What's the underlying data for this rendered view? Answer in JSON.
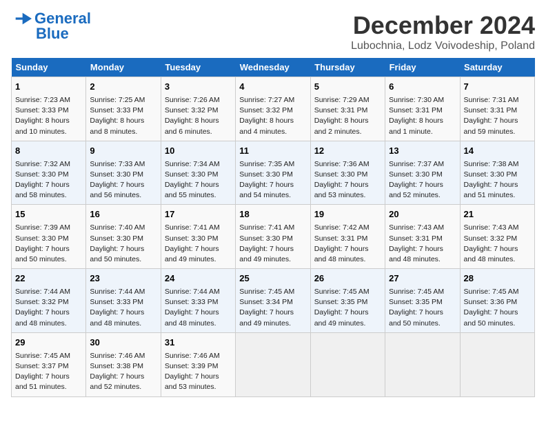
{
  "logo": {
    "line1": "General",
    "line2": "Blue"
  },
  "title": "December 2024",
  "subtitle": "Lubochnia, Lodz Voivodeship, Poland",
  "days_of_week": [
    "Sunday",
    "Monday",
    "Tuesday",
    "Wednesday",
    "Thursday",
    "Friday",
    "Saturday"
  ],
  "weeks": [
    [
      {
        "day": 1,
        "lines": [
          "Sunrise: 7:23 AM",
          "Sunset: 3:33 PM",
          "Daylight: 8 hours",
          "and 10 minutes."
        ]
      },
      {
        "day": 2,
        "lines": [
          "Sunrise: 7:25 AM",
          "Sunset: 3:33 PM",
          "Daylight: 8 hours",
          "and 8 minutes."
        ]
      },
      {
        "day": 3,
        "lines": [
          "Sunrise: 7:26 AM",
          "Sunset: 3:32 PM",
          "Daylight: 8 hours",
          "and 6 minutes."
        ]
      },
      {
        "day": 4,
        "lines": [
          "Sunrise: 7:27 AM",
          "Sunset: 3:32 PM",
          "Daylight: 8 hours",
          "and 4 minutes."
        ]
      },
      {
        "day": 5,
        "lines": [
          "Sunrise: 7:29 AM",
          "Sunset: 3:31 PM",
          "Daylight: 8 hours",
          "and 2 minutes."
        ]
      },
      {
        "day": 6,
        "lines": [
          "Sunrise: 7:30 AM",
          "Sunset: 3:31 PM",
          "Daylight: 8 hours",
          "and 1 minute."
        ]
      },
      {
        "day": 7,
        "lines": [
          "Sunrise: 7:31 AM",
          "Sunset: 3:31 PM",
          "Daylight: 7 hours",
          "and 59 minutes."
        ]
      }
    ],
    [
      {
        "day": 8,
        "lines": [
          "Sunrise: 7:32 AM",
          "Sunset: 3:30 PM",
          "Daylight: 7 hours",
          "and 58 minutes."
        ]
      },
      {
        "day": 9,
        "lines": [
          "Sunrise: 7:33 AM",
          "Sunset: 3:30 PM",
          "Daylight: 7 hours",
          "and 56 minutes."
        ]
      },
      {
        "day": 10,
        "lines": [
          "Sunrise: 7:34 AM",
          "Sunset: 3:30 PM",
          "Daylight: 7 hours",
          "and 55 minutes."
        ]
      },
      {
        "day": 11,
        "lines": [
          "Sunrise: 7:35 AM",
          "Sunset: 3:30 PM",
          "Daylight: 7 hours",
          "and 54 minutes."
        ]
      },
      {
        "day": 12,
        "lines": [
          "Sunrise: 7:36 AM",
          "Sunset: 3:30 PM",
          "Daylight: 7 hours",
          "and 53 minutes."
        ]
      },
      {
        "day": 13,
        "lines": [
          "Sunrise: 7:37 AM",
          "Sunset: 3:30 PM",
          "Daylight: 7 hours",
          "and 52 minutes."
        ]
      },
      {
        "day": 14,
        "lines": [
          "Sunrise: 7:38 AM",
          "Sunset: 3:30 PM",
          "Daylight: 7 hours",
          "and 51 minutes."
        ]
      }
    ],
    [
      {
        "day": 15,
        "lines": [
          "Sunrise: 7:39 AM",
          "Sunset: 3:30 PM",
          "Daylight: 7 hours",
          "and 50 minutes."
        ]
      },
      {
        "day": 16,
        "lines": [
          "Sunrise: 7:40 AM",
          "Sunset: 3:30 PM",
          "Daylight: 7 hours",
          "and 50 minutes."
        ]
      },
      {
        "day": 17,
        "lines": [
          "Sunrise: 7:41 AM",
          "Sunset: 3:30 PM",
          "Daylight: 7 hours",
          "and 49 minutes."
        ]
      },
      {
        "day": 18,
        "lines": [
          "Sunrise: 7:41 AM",
          "Sunset: 3:30 PM",
          "Daylight: 7 hours",
          "and 49 minutes."
        ]
      },
      {
        "day": 19,
        "lines": [
          "Sunrise: 7:42 AM",
          "Sunset: 3:31 PM",
          "Daylight: 7 hours",
          "and 48 minutes."
        ]
      },
      {
        "day": 20,
        "lines": [
          "Sunrise: 7:43 AM",
          "Sunset: 3:31 PM",
          "Daylight: 7 hours",
          "and 48 minutes."
        ]
      },
      {
        "day": 21,
        "lines": [
          "Sunrise: 7:43 AM",
          "Sunset: 3:32 PM",
          "Daylight: 7 hours",
          "and 48 minutes."
        ]
      }
    ],
    [
      {
        "day": 22,
        "lines": [
          "Sunrise: 7:44 AM",
          "Sunset: 3:32 PM",
          "Daylight: 7 hours",
          "and 48 minutes."
        ]
      },
      {
        "day": 23,
        "lines": [
          "Sunrise: 7:44 AM",
          "Sunset: 3:33 PM",
          "Daylight: 7 hours",
          "and 48 minutes."
        ]
      },
      {
        "day": 24,
        "lines": [
          "Sunrise: 7:44 AM",
          "Sunset: 3:33 PM",
          "Daylight: 7 hours",
          "and 48 minutes."
        ]
      },
      {
        "day": 25,
        "lines": [
          "Sunrise: 7:45 AM",
          "Sunset: 3:34 PM",
          "Daylight: 7 hours",
          "and 49 minutes."
        ]
      },
      {
        "day": 26,
        "lines": [
          "Sunrise: 7:45 AM",
          "Sunset: 3:35 PM",
          "Daylight: 7 hours",
          "and 49 minutes."
        ]
      },
      {
        "day": 27,
        "lines": [
          "Sunrise: 7:45 AM",
          "Sunset: 3:35 PM",
          "Daylight: 7 hours",
          "and 50 minutes."
        ]
      },
      {
        "day": 28,
        "lines": [
          "Sunrise: 7:45 AM",
          "Sunset: 3:36 PM",
          "Daylight: 7 hours",
          "and 50 minutes."
        ]
      }
    ],
    [
      {
        "day": 29,
        "lines": [
          "Sunrise: 7:45 AM",
          "Sunset: 3:37 PM",
          "Daylight: 7 hours",
          "and 51 minutes."
        ]
      },
      {
        "day": 30,
        "lines": [
          "Sunrise: 7:46 AM",
          "Sunset: 3:38 PM",
          "Daylight: 7 hours",
          "and 52 minutes."
        ]
      },
      {
        "day": 31,
        "lines": [
          "Sunrise: 7:46 AM",
          "Sunset: 3:39 PM",
          "Daylight: 7 hours",
          "and 53 minutes."
        ]
      },
      null,
      null,
      null,
      null
    ]
  ]
}
